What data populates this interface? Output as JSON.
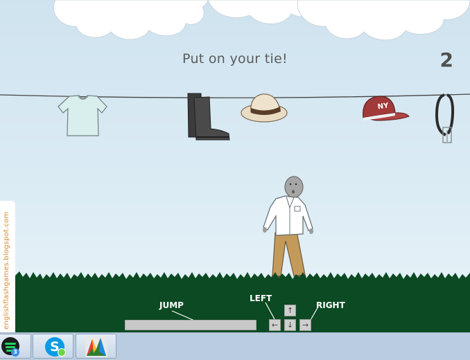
{
  "game": {
    "instruction": "Put on your tie!",
    "score": "2"
  },
  "clothesline_items": [
    {
      "name": "t-shirt"
    },
    {
      "name": "boots"
    },
    {
      "name": "fedora-hat"
    },
    {
      "name": "baseball-cap",
      "text": "NY"
    },
    {
      "name": "belt"
    }
  ],
  "sidebar": {
    "url": "englishflashgames.blogspot.com"
  },
  "controls": {
    "jump_label": "JUMP",
    "left_label": "LEFT",
    "right_label": "RIGHT",
    "up_key": "↑",
    "down_key": "↓",
    "left_key": "←",
    "right_key": "→"
  },
  "taskbar": {
    "items": [
      {
        "icon": "spotify-icon",
        "badge": "3"
      },
      {
        "icon": "skype-icon",
        "letter": "S"
      },
      {
        "icon": "avg-antivirus-icon"
      }
    ]
  },
  "colors": {
    "grass": "#0b4a22",
    "sky": "#d4e7f2",
    "taskbar": "#b9cce0"
  }
}
